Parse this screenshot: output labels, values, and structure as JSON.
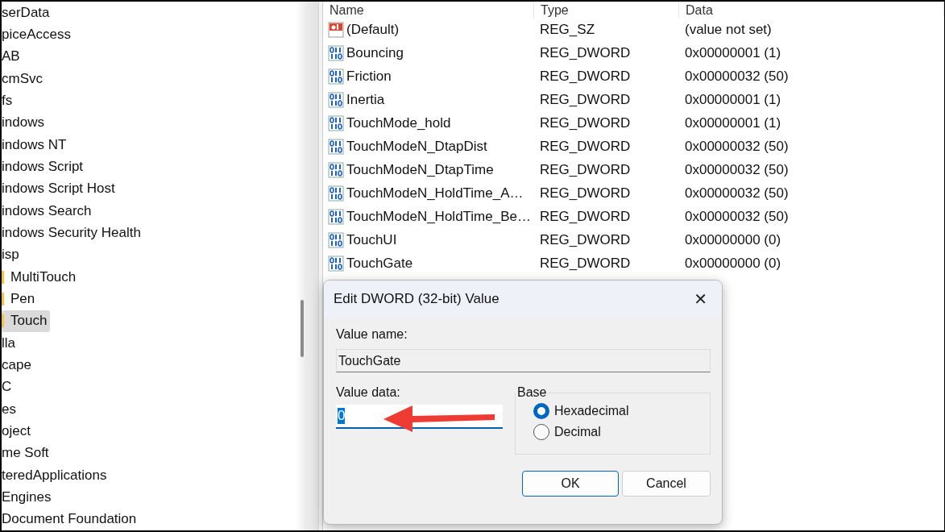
{
  "tree": {
    "items": [
      {
        "label": "serData",
        "selected": false,
        "icon_visible": false
      },
      {
        "label": "piceAccess",
        "selected": false,
        "icon_visible": false
      },
      {
        "label": "AB",
        "selected": false,
        "icon_visible": false
      },
      {
        "label": "cmSvc",
        "selected": false,
        "icon_visible": false
      },
      {
        "label": "fs",
        "selected": false,
        "icon_visible": false
      },
      {
        "label": "indows",
        "selected": false,
        "icon_visible": false
      },
      {
        "label": "indows NT",
        "selected": false,
        "icon_visible": false
      },
      {
        "label": "indows Script",
        "selected": false,
        "icon_visible": false
      },
      {
        "label": "indows Script Host",
        "selected": false,
        "icon_visible": false
      },
      {
        "label": "indows Search",
        "selected": false,
        "icon_visible": false
      },
      {
        "label": "indows Security Health",
        "selected": false,
        "icon_visible": false
      },
      {
        "label": "isp",
        "selected": false,
        "icon_visible": false
      },
      {
        "label": "MultiTouch",
        "selected": false,
        "icon_visible": true
      },
      {
        "label": "Pen",
        "selected": false,
        "icon_visible": true
      },
      {
        "label": "Touch",
        "selected": true,
        "icon_visible": true
      },
      {
        "label": "lla",
        "selected": false,
        "icon_visible": false
      },
      {
        "label": "cape",
        "selected": false,
        "icon_visible": false
      },
      {
        "label": "C",
        "selected": false,
        "icon_visible": false
      },
      {
        "label": "es",
        "selected": false,
        "icon_visible": false
      },
      {
        "label": "oject",
        "selected": false,
        "icon_visible": false
      },
      {
        "label": "me Soft",
        "selected": false,
        "icon_visible": false
      },
      {
        "label": "teredApplications",
        "selected": false,
        "icon_visible": false
      },
      {
        "label": "Engines",
        "selected": false,
        "icon_visible": false
      },
      {
        "label": "Document Foundation",
        "selected": false,
        "icon_visible": false
      }
    ]
  },
  "values": {
    "columns": [
      "Name",
      "Type",
      "Data"
    ],
    "rows": [
      {
        "kind": "string",
        "name": "(Default)",
        "type": "REG_SZ",
        "data": "(value not set)"
      },
      {
        "kind": "dword",
        "name": "Bouncing",
        "type": "REG_DWORD",
        "data": "0x00000001 (1)"
      },
      {
        "kind": "dword",
        "name": "Friction",
        "type": "REG_DWORD",
        "data": "0x00000032 (50)"
      },
      {
        "kind": "dword",
        "name": "Inertia",
        "type": "REG_DWORD",
        "data": "0x00000001 (1)"
      },
      {
        "kind": "dword",
        "name": "TouchMode_hold",
        "type": "REG_DWORD",
        "data": "0x00000001 (1)"
      },
      {
        "kind": "dword",
        "name": "TouchModeN_DtapDist",
        "type": "REG_DWORD",
        "data": "0x00000032 (50)"
      },
      {
        "kind": "dword",
        "name": "TouchModeN_DtapTime",
        "type": "REG_DWORD",
        "data": "0x00000032 (50)"
      },
      {
        "kind": "dword",
        "name": "TouchModeN_HoldTime_A…",
        "type": "REG_DWORD",
        "data": "0x00000032 (50)"
      },
      {
        "kind": "dword",
        "name": "TouchModeN_HoldTime_Be…",
        "type": "REG_DWORD",
        "data": "0x00000032 (50)"
      },
      {
        "kind": "dword",
        "name": "TouchUI",
        "type": "REG_DWORD",
        "data": "0x00000000 (0)"
      },
      {
        "kind": "dword",
        "name": "TouchGate",
        "type": "REG_DWORD",
        "data": "0x00000000 (0)"
      }
    ]
  },
  "dialog": {
    "title": "Edit DWORD (32-bit) Value",
    "close": "✕",
    "value_name_label": "Value name:",
    "value_name": "TouchGate",
    "value_data_label": "Value data:",
    "value_data": "0",
    "base": {
      "label": "Base",
      "options": [
        {
          "label": "Hexadecimal",
          "selected": true
        },
        {
          "label": "Decimal",
          "selected": false
        }
      ]
    },
    "buttons": [
      {
        "label": "OK",
        "kind": "primary"
      },
      {
        "label": "Cancel",
        "kind": "secondary"
      }
    ]
  }
}
